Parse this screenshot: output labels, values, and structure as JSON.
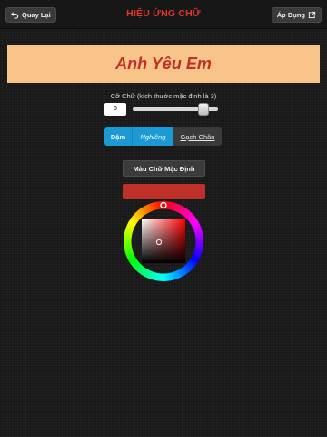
{
  "header": {
    "back_label": "Quay Lại",
    "title": "HIỆU ỨNG CHỮ",
    "apply_label": "Áp Dụng"
  },
  "preview": {
    "text": "Anh Yêu Em",
    "text_color": "#c0302a",
    "background_color": "#f8c48a"
  },
  "font_size": {
    "label": "Cỡ Chữ (kích thước mặc định là 3)",
    "value": "6",
    "slider_fraction": 0.83
  },
  "style_buttons": {
    "bold": "Đậm",
    "italic": "Nghiêng",
    "underline": "Gạch Chân"
  },
  "default_color_button": "Màu Chữ Mặc Định",
  "selected_color": "#c0302a",
  "colors": {
    "accent_blue": "#1b9ad6",
    "title_red": "#e0362c"
  }
}
